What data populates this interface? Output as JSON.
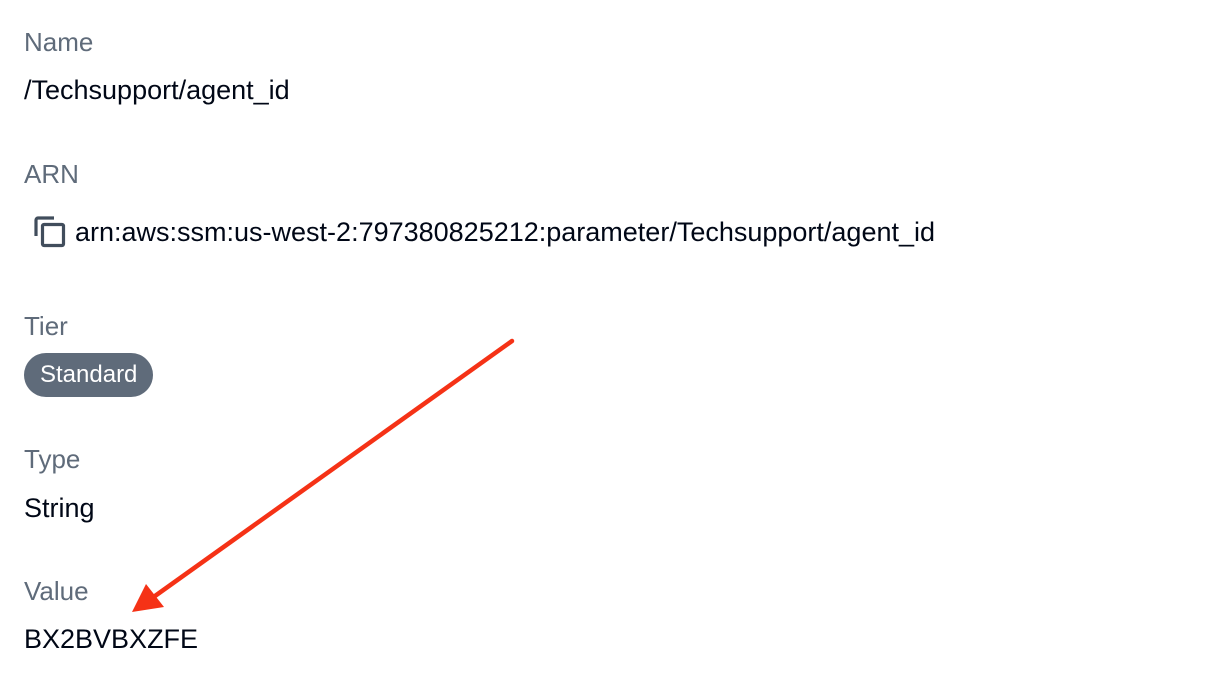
{
  "parameter": {
    "name_label": "Name",
    "name_value": "/Techsupport/agent_id",
    "arn_label": "ARN",
    "arn_value": "arn:aws:ssm:us-west-2:797380825212:parameter/Techsupport/agent_id",
    "tier_label": "Tier",
    "tier_value": "Standard",
    "type_label": "Type",
    "type_value": "String",
    "value_label": "Value",
    "value_value": "BX2BVBXZFE"
  },
  "icons": {
    "copy": "copy-icon"
  },
  "colors": {
    "label": "#5f6b7a",
    "text": "#000716",
    "badge_bg": "#5f6b7a",
    "badge_text": "#ffffff",
    "annotation_arrow": "#f53216"
  }
}
